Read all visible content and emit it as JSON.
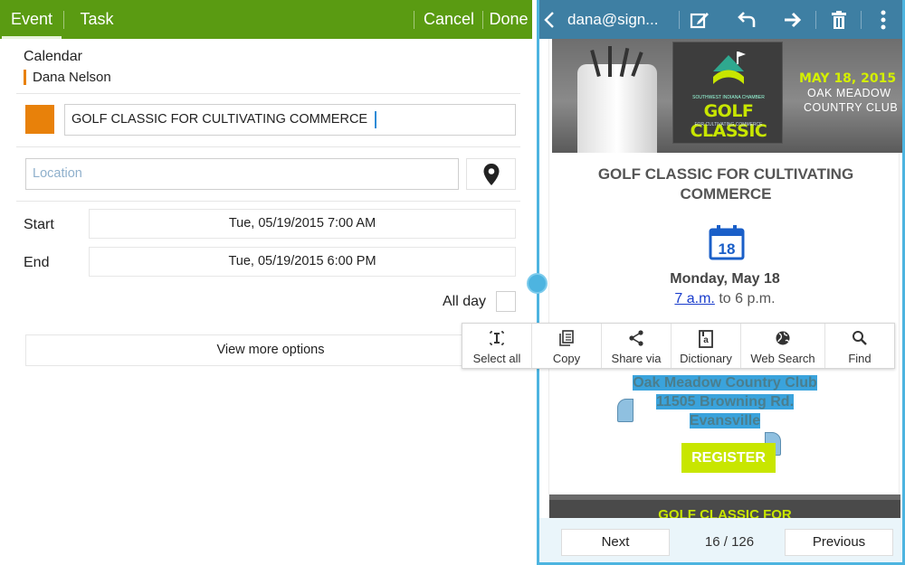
{
  "left_toolbar": {
    "tab_event": "Event",
    "tab_task": "Task",
    "cancel": "Cancel",
    "done": "Done"
  },
  "form": {
    "calendar_label": "Calendar",
    "calendar_owner": "Dana Nelson",
    "event_color": "#e8810a",
    "title_value": "GOLF CLASSIC FOR CULTIVATING COMMERCE",
    "location_placeholder": "Location",
    "start_label": "Start",
    "start_value": "Tue, 05/19/2015  7:00  AM",
    "end_label": "End",
    "end_value": "Tue, 05/19/2015  6:00  PM",
    "allday_label": "All day",
    "more_options": "View more options"
  },
  "right_toolbar": {
    "email_title": "dana@sign...",
    "icons": [
      "back-icon",
      "edit-icon",
      "reply-icon",
      "forward-icon",
      "delete-icon",
      "more-icon"
    ]
  },
  "email": {
    "banner": {
      "logo_sub": "SOUTHWEST INDIANA CHAMBER",
      "logo_main": "GOLF CLASSIC",
      "logo_sub2": "FOR CULTIVATING COMMERCE",
      "date": "MAY 18, 2015",
      "venue_line1": "OAK MEADOW",
      "venue_line2": "COUNTRY CLUB"
    },
    "event_title": "GOLF CLASSIC FOR CULTIVATING COMMERCE",
    "calendar_day_number": "18",
    "event_day": "Monday, May 18",
    "time_start": "7 a.m.",
    "time_rest": " to 6 p.m.",
    "venue_name": "Oak Meadow Country Club",
    "venue_street": "11505 Browning Rd.",
    "venue_city": "Evansville",
    "register": "REGISTER",
    "footer_text": "GOLF CLASSIC FOR"
  },
  "nav": {
    "next": "Next",
    "page_count": "16 / 126",
    "previous": "Previous"
  },
  "context_menu": {
    "items": [
      {
        "label": "Select all",
        "icon": "select-all-icon"
      },
      {
        "label": "Copy",
        "icon": "copy-icon"
      },
      {
        "label": "Share via",
        "icon": "share-icon"
      },
      {
        "label": "Dictionary",
        "icon": "dictionary-icon"
      },
      {
        "label": "Web Search",
        "icon": "globe-icon"
      },
      {
        "label": "Find",
        "icon": "search-icon"
      }
    ]
  },
  "colors": {
    "left_toolbar": "#5a9b12",
    "right_toolbar": "#3e7fa3",
    "accent": "#4db4e0",
    "selection": "#3aa3dc",
    "register": "#c8e600"
  }
}
